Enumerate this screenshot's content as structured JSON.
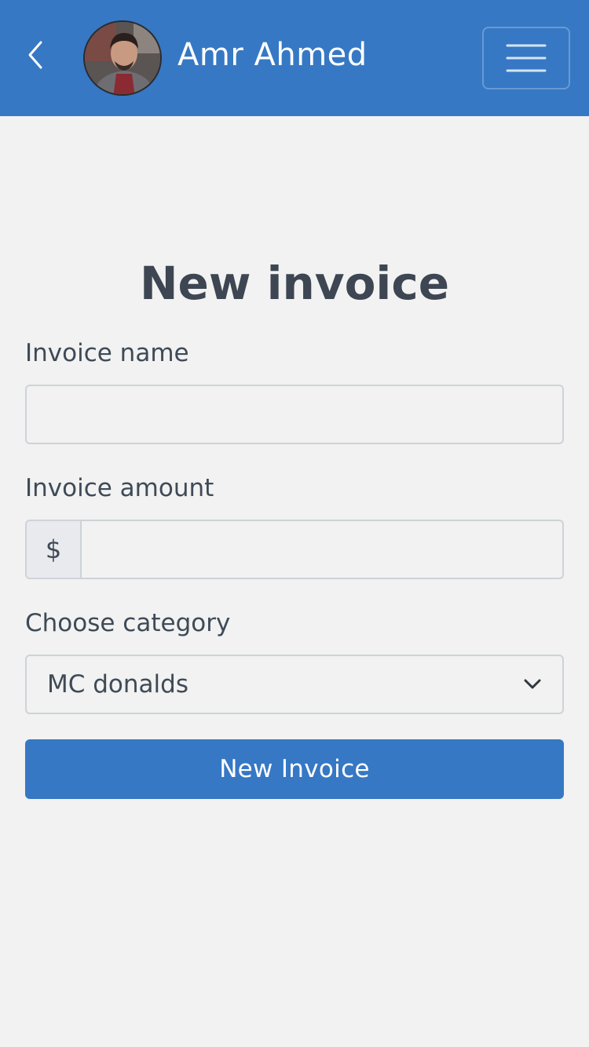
{
  "header": {
    "back_icon": "chevron-left-icon",
    "user_name": "Amr Ahmed",
    "avatar_alt": "",
    "menu_icon": "hamburger-menu-icon",
    "background_color": "#3678c4"
  },
  "form": {
    "title": "New invoice",
    "invoice_name": {
      "label": "Invoice name",
      "value": "",
      "placeholder": ""
    },
    "invoice_amount": {
      "label": "Invoice amount",
      "currency_symbol": "$",
      "value": "",
      "placeholder": ""
    },
    "category": {
      "label": "Choose category",
      "selected": "MC donalds",
      "icon": "chevron-down-icon"
    },
    "submit_label": "New Invoice"
  },
  "colors": {
    "primary": "#3678c4",
    "background": "#f1f2f1",
    "text": "#3f4a57",
    "border": "#ced3d8"
  }
}
